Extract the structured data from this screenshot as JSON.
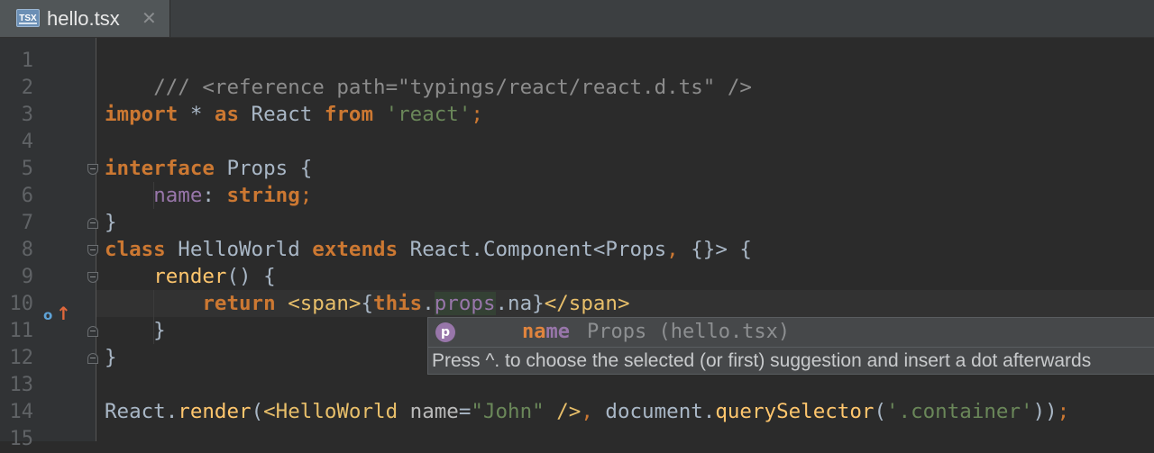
{
  "tab": {
    "icon_text": "TSX",
    "title": "hello.tsx",
    "close_glyph": "✕"
  },
  "gutter": {
    "line_numbers": [
      "1",
      "2",
      "3",
      "4",
      "5",
      "6",
      "7",
      "8",
      "9",
      "10",
      "11",
      "12",
      "13",
      "14",
      "15"
    ],
    "implement_marker": "o",
    "override_marker": "↑"
  },
  "code": {
    "l1": {
      "text": "/// <reference path=\"typings/react/react.d.ts\" />"
    },
    "l3": {
      "kw_import": "import",
      "star": " * ",
      "kw_as": "as",
      "mid": " React ",
      "kw_from": "from",
      "sp": " ",
      "str": "'react'",
      "semi": ";"
    },
    "l5": {
      "kw": "interface",
      "rest": " Props {"
    },
    "l6": {
      "indent": "    ",
      "field": "name",
      "colon": ": ",
      "type": "string",
      "semi": ";"
    },
    "l7": {
      "text": "}"
    },
    "l8": {
      "kw_class": "class",
      "name": " HelloWorld ",
      "kw_extends": "extends",
      "base": " React.Component<Props",
      "comma": ",",
      "rest": " {}> {"
    },
    "l9": {
      "indent": "    ",
      "fn": "render",
      "rest": "() {"
    },
    "l10": {
      "indent": "        ",
      "kw": "return",
      "sp": " ",
      "tag_open": "<span>",
      "brace_open": "{",
      "kw_this": "this",
      "dot1": ".",
      "props": "props",
      "dot2": ".",
      "partial": "na",
      "brace_close": "}",
      "tag_close": "</span>"
    },
    "l11": {
      "text": "    }"
    },
    "l12": {
      "text": "}"
    },
    "l14": {
      "obj": "React.",
      "fn_render": "render",
      "paren": "(",
      "tag_start": "<HelloWorld",
      "sp": " ",
      "attr": "name",
      "eq": "=",
      "attr_val": "\"John\"",
      "tag_end": " />",
      "comma": ",",
      "doc": " document.",
      "fn_qs": "querySelector",
      "paren2": "(",
      "sel_str": "'.container'",
      "close": "))",
      "semi": ";"
    }
  },
  "completion": {
    "badge": "p",
    "name_match": "na",
    "name_rest": "me",
    "type_info": "Props (hello.tsx)",
    "hint": "Press ^. to choose the selected (or first) suggestion and insert a dot afterwards"
  },
  "colors": {
    "background": "#2b2b2b",
    "keyword": "#cc7832",
    "string": "#6a8759",
    "field": "#9876aa",
    "function": "#ffc66d",
    "comment": "#8c8c8c"
  }
}
